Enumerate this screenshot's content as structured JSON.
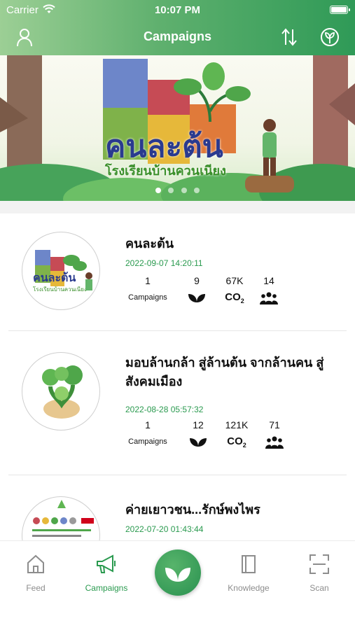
{
  "status_bar": {
    "carrier": "Carrier",
    "time": "10:07 PM"
  },
  "nav": {
    "title": "Campaigns",
    "left_icon": "profile-icon",
    "right_icons": [
      "sort-icon",
      "location-leaf-icon"
    ]
  },
  "banner": {
    "image": "illustration of puzzle pieces with a sprouting tree and a person",
    "headline": "คนละต้น",
    "school": "โรงเรียนบ้านควนเนียง",
    "slides": 4,
    "active_slide": 0
  },
  "campaigns": [
    {
      "name": "คนละต้น",
      "date": "2022-09-07 14:20:11",
      "campaigns_count": "1",
      "campaigns_label": "Campaigns",
      "trees": "9",
      "co2": "67K",
      "members": "14"
    },
    {
      "name": "มอบล้านกล้า สู่ล้านต้น จากล้านคน สู่สังคมเมือง",
      "date": "2022-08-28 05:57:32",
      "campaigns_count": "1",
      "campaigns_label": "Campaigns",
      "trees": "12",
      "co2": "121K",
      "members": "71"
    },
    {
      "name": "ค่ายเยาวชน...รักษ์พงไพร",
      "date": "2022-07-20 01:43:44",
      "campaigns_count": "",
      "campaigns_label": "",
      "trees": "",
      "co2": "",
      "members": ""
    }
  ],
  "co2_label": "CO",
  "co2_sub": "2",
  "tabbar": {
    "tabs": [
      {
        "label": "Feed",
        "icon": "home-icon"
      },
      {
        "label": "Campaigns",
        "icon": "megaphone-icon",
        "active": true
      },
      {
        "label": "",
        "icon": "leaf-icon"
      },
      {
        "label": "Knowledge",
        "icon": "book-icon"
      },
      {
        "label": "Scan",
        "icon": "scan-icon"
      }
    ]
  },
  "colors": {
    "accent": "#2a9a4f",
    "header_start": "#9ccf95",
    "header_end": "#2f9a57"
  }
}
